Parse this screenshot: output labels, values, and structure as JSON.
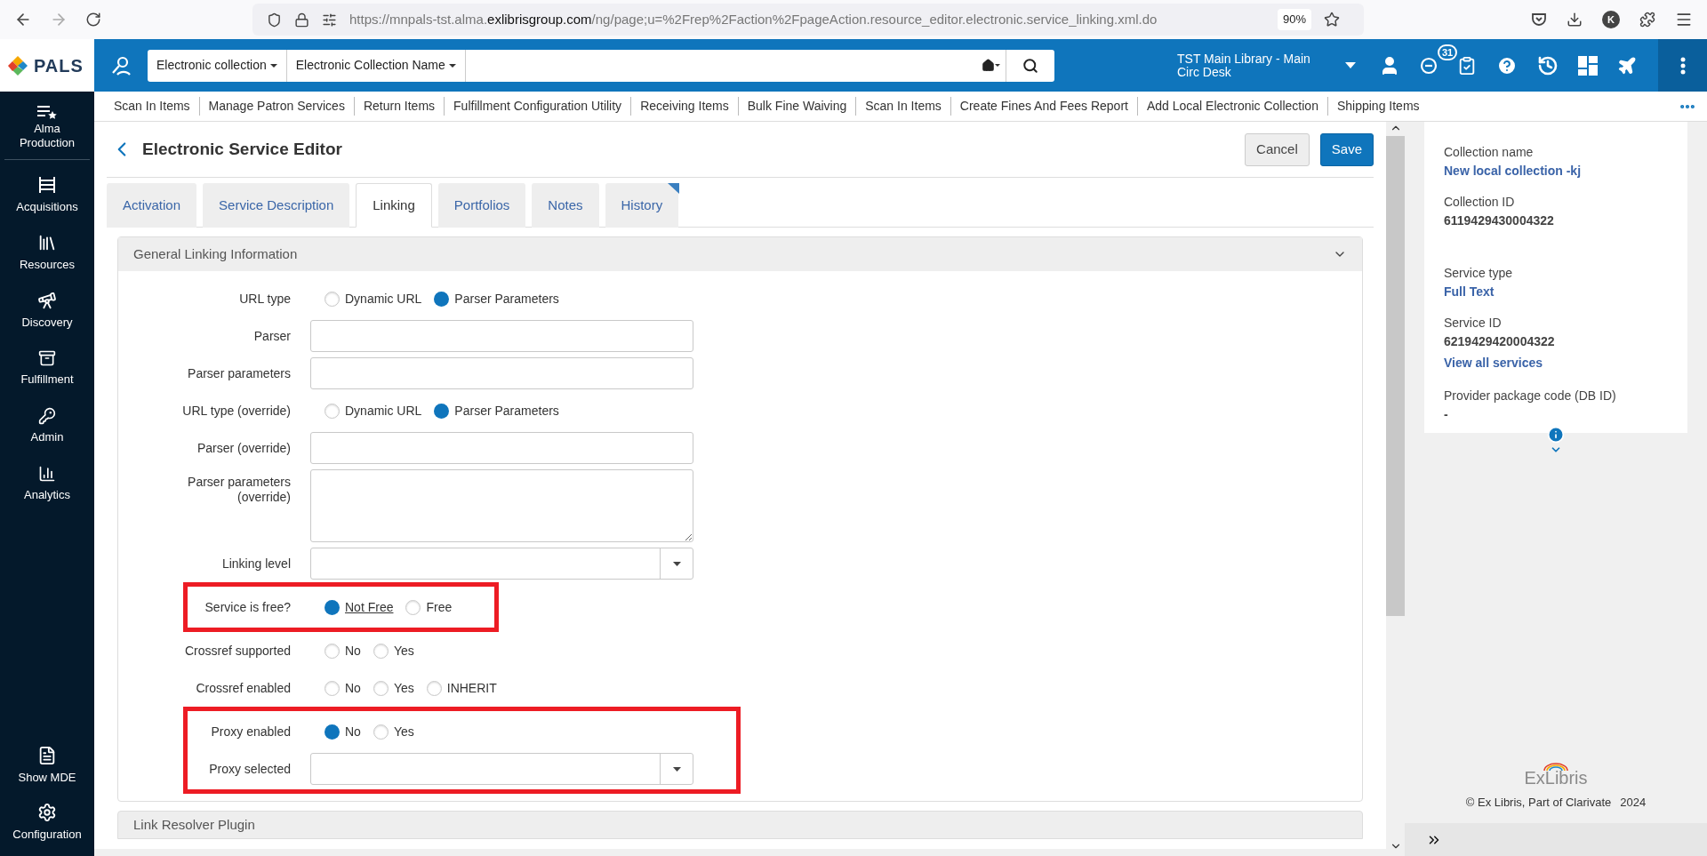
{
  "browser": {
    "url_start": "https://mnpals-tst.alma.",
    "url_domain": "exlibrisgroup.com",
    "url_end": "/ng/page;u=%2Frep%2Faction%2FpageAction.resource_editor.electronic.service_linking.xml.do",
    "zoom": "90%",
    "profile_initial": "K"
  },
  "header": {
    "logo": "PALS",
    "search_scopes": [
      "Electronic collection",
      "Electronic Collection Name"
    ],
    "location": "TST Main Library - Main Circ Desk",
    "notification_count": "31"
  },
  "quick_links": [
    "Scan In Items",
    "Manage Patron Services",
    "Return Items",
    "Fulfillment Configuration Utility",
    "Receiving Items",
    "Bulk Fine Waiving",
    "Scan In Items",
    "Create Fines And Fees Report",
    "Add Local Electronic Collection",
    "Shipping Items"
  ],
  "sidebar": {
    "top": "Alma Production",
    "items": [
      "Acquisitions",
      "Resources",
      "Discovery",
      "Fulfillment",
      "Admin",
      "Analytics"
    ],
    "bottom": [
      "Show MDE",
      "Configuration"
    ]
  },
  "page": {
    "title": "Electronic Service Editor",
    "cancel": "Cancel",
    "save": "Save",
    "tabs": [
      {
        "label": "Activation",
        "selected": false
      },
      {
        "label": "Service Description",
        "selected": false
      },
      {
        "label": "Linking",
        "selected": true
      },
      {
        "label": "Portfolios",
        "selected": false
      },
      {
        "label": "Notes",
        "selected": false
      },
      {
        "label": "History",
        "selected": false
      }
    ],
    "sections": [
      {
        "title": "General Linking Information",
        "expanded": true,
        "rows": [
          {
            "kind": "radio",
            "label": "URL type",
            "options": [
              {
                "label": "Dynamic URL",
                "selected": false
              },
              {
                "label": "Parser Parameters",
                "selected": true
              }
            ]
          },
          {
            "kind": "text",
            "label": "Parser"
          },
          {
            "kind": "text",
            "label": "Parser parameters"
          },
          {
            "kind": "radio",
            "label": "URL type (override)",
            "options": [
              {
                "label": "Dynamic URL",
                "selected": false
              },
              {
                "label": "Parser Parameters",
                "selected": true
              }
            ]
          },
          {
            "kind": "text",
            "label": "Parser (override)"
          },
          {
            "kind": "textarea",
            "label": "Parser parameters (override)"
          },
          {
            "kind": "select",
            "label": "Linking level"
          },
          {
            "kind": "highlight",
            "rows": [
              {
                "kind": "radio",
                "label": "Service is free?",
                "options": [
                  {
                    "label": "Not Free",
                    "selected": true,
                    "focused": true
                  },
                  {
                    "label": "Free",
                    "selected": false,
                    "focused": false
                  }
                ]
              }
            ]
          },
          {
            "kind": "radio",
            "label": "Crossref supported",
            "options": [
              {
                "label": "No",
                "selected": false
              },
              {
                "label": "Yes",
                "selected": false
              }
            ]
          },
          {
            "kind": "radio",
            "label": "Crossref enabled",
            "options": [
              {
                "label": "No",
                "selected": false
              },
              {
                "label": "Yes",
                "selected": false
              },
              {
                "label": "INHERIT",
                "selected": false
              }
            ]
          },
          {
            "kind": "highlight",
            "rows": [
              {
                "kind": "radio",
                "label": "Proxy enabled",
                "options": [
                  {
                    "label": "No",
                    "selected": true
                  },
                  {
                    "label": "Yes",
                    "selected": false
                  }
                ]
              },
              {
                "kind": "select",
                "label": "Proxy selected"
              }
            ]
          }
        ]
      },
      {
        "title": "Link Resolver Plugin"
      }
    ]
  },
  "info_panel": {
    "fields": [
      {
        "label": "Collection name",
        "value": "New local collection -kj",
        "kind": "link"
      },
      {
        "label": "Collection ID",
        "value": "6119429430004322",
        "kind": "text"
      },
      {
        "label": "Service type",
        "value": "Full Text",
        "kind": "link"
      },
      {
        "label": "Service ID",
        "value": "6219429420004322",
        "kind": "text",
        "link": "View all services"
      },
      {
        "label": "Provider package code (DB ID)",
        "value": "-",
        "kind": "text"
      }
    ]
  },
  "footer": {
    "brand": "ExLibris",
    "copyright": "© Ex Libris, Part of Clarivate",
    "year": "2024"
  }
}
